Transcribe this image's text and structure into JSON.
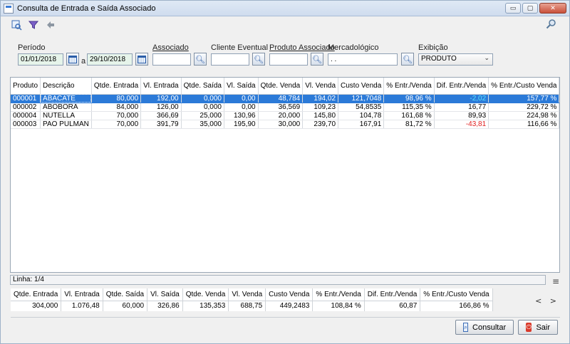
{
  "window": {
    "title": "Consulta de Entrada e Saída Associado",
    "btn_minimize": "▭",
    "btn_maximize": "▢",
    "btn_close": "✕"
  },
  "toolbar": {
    "icons": [
      "query-icon",
      "filter-icon",
      "back-arrow-icon"
    ],
    "search_icon": "search-icon"
  },
  "filters": {
    "periodo_label": "Período",
    "date_from": "01/01/2018",
    "between": "a",
    "date_to": "29/10/2018",
    "associado_label": "Associado",
    "associado_value": "",
    "cliente_label": "Cliente Eventual",
    "cliente_value": "",
    "produto_label": "Produto Associado",
    "produto_value": "",
    "mercadologico_label": "Mercadológico",
    "mercadologico_value": ". .",
    "exibicao_label": "Exibição",
    "exibicao_value": "PRODUTO"
  },
  "table": {
    "columns": [
      "Produto",
      "Descrição",
      "Qtde. Entrada",
      "Vl. Entrada",
      "Qtde. Saída",
      "Vl. Saída",
      "Qtde. Venda",
      "Vl. Venda",
      "Custo Venda",
      "% Entr./Venda",
      "Dif. Entr./Venda",
      "% Entr./Custo Venda"
    ],
    "rows": [
      [
        "000001",
        "ABACATE",
        "80,000",
        "192,00",
        "0,000",
        "0,00",
        "48,784",
        "194,02",
        "121,7048",
        "98,96 %",
        "-2,02",
        "157,77 %"
      ],
      [
        "000002",
        "ABOBORA",
        "84,000",
        "126,00",
        "0,000",
        "0,00",
        "36,569",
        "109,23",
        "54,8535",
        "115,35 %",
        "16,77",
        "229,72 %"
      ],
      [
        "000004",
        "NUTELLA",
        "70,000",
        "366,69",
        "25,000",
        "130,96",
        "20,000",
        "145,80",
        "104,78",
        "161,68 %",
        "89,93",
        "224,98 %"
      ],
      [
        "000003",
        "PAO PULMAN",
        "70,000",
        "391,79",
        "35,000",
        "195,90",
        "30,000",
        "239,70",
        "167,91",
        "81,72 %",
        "-43,81",
        "116,66 %"
      ]
    ]
  },
  "status": {
    "linha": "Linha: 1/4",
    "menu_icon": "≡"
  },
  "totals": {
    "columns": [
      "Qtde. Entrada",
      "Vl. Entrada",
      "Qtde. Saída",
      "Vl. Saída",
      "Qtde. Venda",
      "Vl. Venda",
      "Custo Venda",
      "% Entr./Venda",
      "Dif. Entr./Venda",
      "% Entr./Custo Venda"
    ],
    "values": [
      "304,000",
      "1.076,48",
      "60,000",
      "326,86",
      "135,353",
      "688,75",
      "449,2483",
      "108,84 %",
      "60,87",
      "166,86 %"
    ],
    "arrows": "< >"
  },
  "buttons": {
    "consultar": "Consultar",
    "sair": "Sair"
  },
  "colors": {
    "selection": "#2b7ad8",
    "negative": "#e02020",
    "negative_selected": "#58e4ff"
  }
}
